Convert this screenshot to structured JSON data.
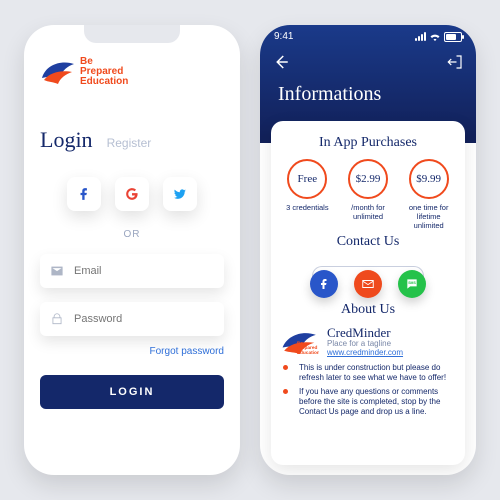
{
  "brand": {
    "line1": "Be",
    "line2": "Prepared",
    "line3": "Education"
  },
  "left": {
    "tabs": {
      "login": "Login",
      "register": "Register"
    },
    "social": {
      "facebook": "facebook-icon",
      "google": "google-icon",
      "twitter": "twitter-icon"
    },
    "or": "OR",
    "email_placeholder": "Email",
    "password_placeholder": "Password",
    "forgot": "Forgot password",
    "login_button": "LOGIN"
  },
  "right": {
    "status_time": "9:41",
    "title": "Informations",
    "sections": {
      "iap": "In App Purchases",
      "contact": "Contact Us",
      "about": "About Us"
    },
    "plans": [
      {
        "price": "Free",
        "sub": "3 credentials"
      },
      {
        "price": "$2.99",
        "sub": "/month for unlimited"
      },
      {
        "price": "$9.99",
        "sub": "one time for lifetime unlimited"
      }
    ],
    "about": {
      "name": "CredMinder",
      "tagline": "Place for a tagline",
      "url": "www.credminder.com"
    },
    "bullets": [
      "This is under construction but please do refresh later to see what we have to offer!",
      "If you have any questions or comments before the site is completed, stop by the Contact Us page and drop us a line."
    ]
  }
}
